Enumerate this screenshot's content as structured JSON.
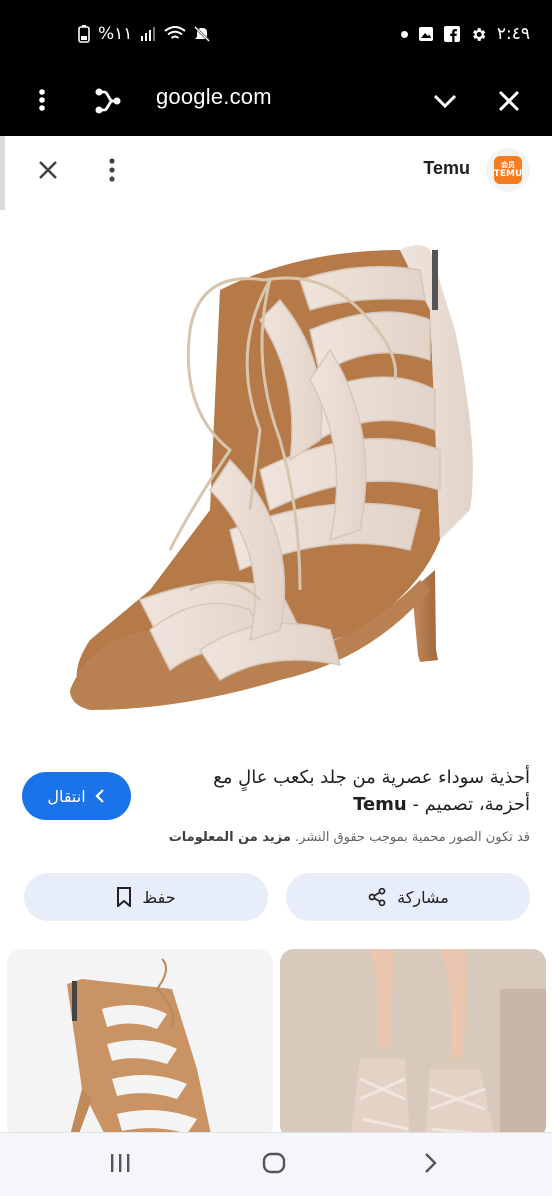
{
  "status": {
    "time": "٢:٤٩",
    "battery": "%١١"
  },
  "browser": {
    "url": "google.com"
  },
  "viewer": {
    "site_name": "Temu",
    "logo_text_top": "会员",
    "logo_text_bottom": "TEMU",
    "caption_line1": "أحذية سوداء عصرية من جلد بكعب عالٍ مع",
    "caption_line2_prefix": "أحزمة، تصميم - ",
    "caption_line2_brand": "Temu",
    "visit_label": "انتقال",
    "copyright_text": "قد تكون الصور محمية بموجب حقوق النشر.",
    "copyright_more": "مزيد من المعلومات",
    "save_label": "حفظ",
    "share_label": "مشاركة"
  },
  "icons": {
    "close": "close-icon",
    "more": "more-vert-icon",
    "share": "share-icon",
    "chevron": "chevron-down-icon",
    "bookmark": "bookmark-icon",
    "back": "chevron-left-icon"
  },
  "colors": {
    "accent": "#1a73e8",
    "chip": "#e8eef9",
    "brand": "#f57c1f"
  }
}
